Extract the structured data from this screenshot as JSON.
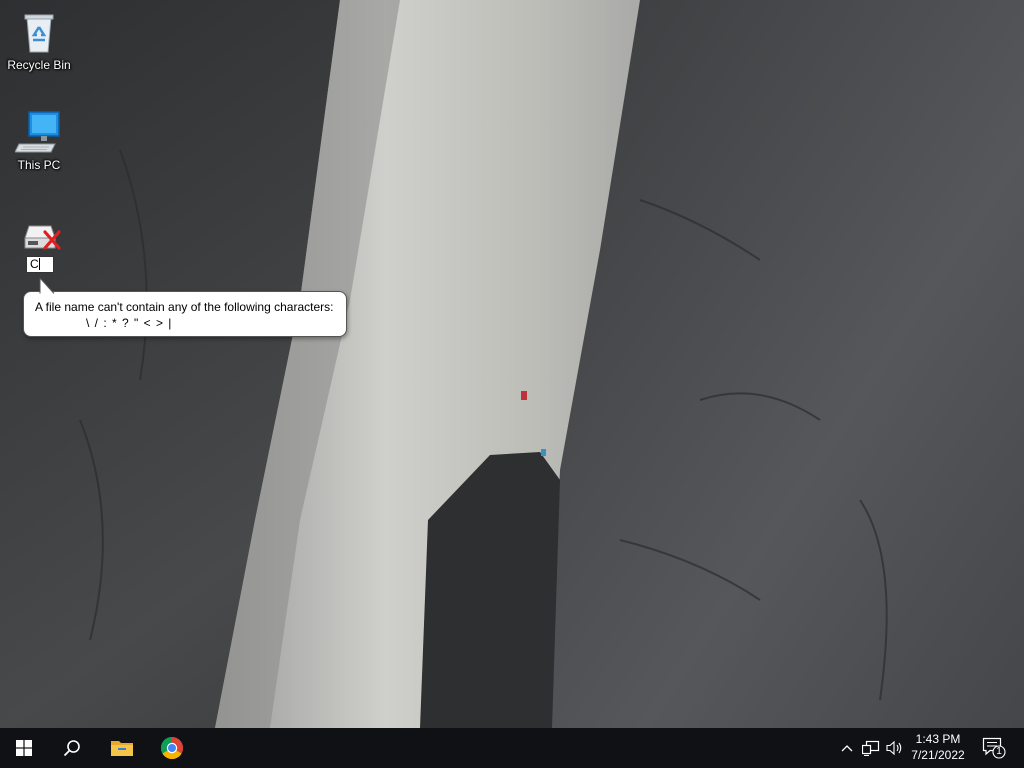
{
  "desktop": {
    "icons": [
      {
        "label": "Recycle Bin",
        "icon": "recycle-bin-icon"
      },
      {
        "label": "This PC",
        "icon": "computer-icon"
      },
      {
        "label": "",
        "icon": "disconnected-network-drive-icon"
      }
    ],
    "rename_value": "C"
  },
  "tooltip": {
    "line1": "A file name can't contain any of the following characters:",
    "line2": "\\ / : * ? \" < > |"
  },
  "taskbar": {
    "start_icon": "windows-start-icon",
    "search_icon": "search-icon",
    "pinned": [
      "file-explorer-icon",
      "chrome-icon"
    ],
    "tray": {
      "chevron_icon": "chevron-up-icon",
      "network_icon": "network-icon",
      "volume_icon": "volume-icon",
      "time": "1:43 PM",
      "date": "7/21/2022",
      "notification_icon": "action-center-icon",
      "notification_count": "1"
    }
  },
  "colors": {
    "taskbar_bg": "#101114",
    "explorer_yellow": "#f3c64a",
    "error_red": "#e02020"
  }
}
